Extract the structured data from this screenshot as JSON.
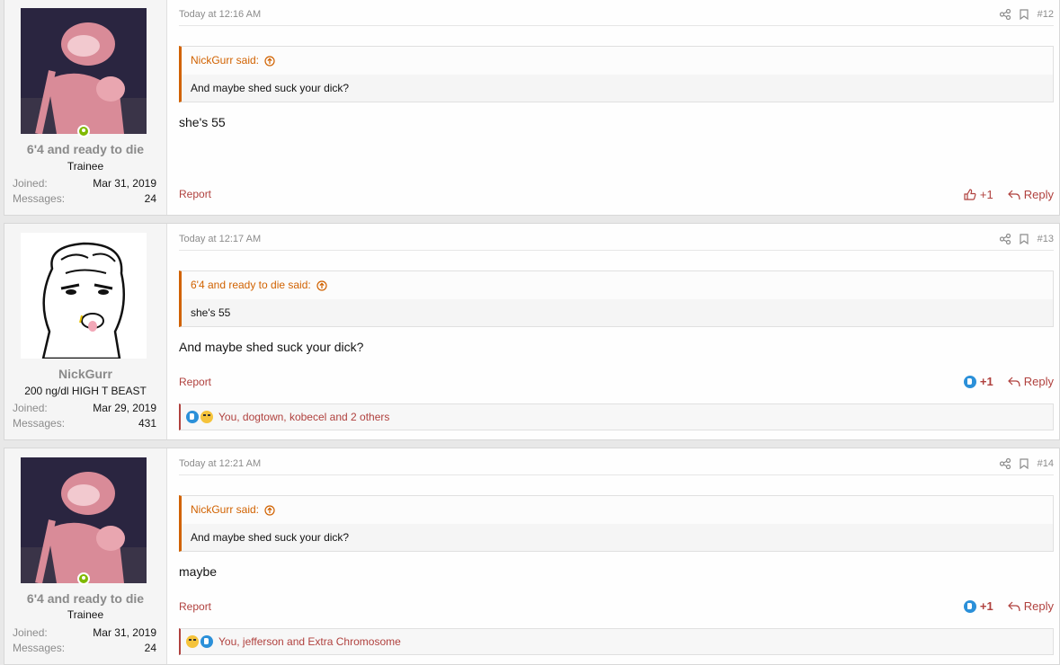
{
  "posts": [
    {
      "user": {
        "name": "6'4 and ready to die",
        "title": "Trainee",
        "joined_label": "Joined:",
        "joined": "Mar 31, 2019",
        "messages_label": "Messages:",
        "messages": "24"
      },
      "time": "Today at 12:16 AM",
      "number": "#12",
      "quote": {
        "author": "NickGurr said:",
        "text": "And maybe shed suck your dick?"
      },
      "text": "she's 55",
      "report": "Report",
      "like": "+1",
      "reply": "Reply"
    },
    {
      "user": {
        "name": "NickGurr",
        "title": "200 ng/dl HIGH T BEAST",
        "joined_label": "Joined:",
        "joined": "Mar 29, 2019",
        "messages_label": "Messages:",
        "messages": "431"
      },
      "time": "Today at 12:17 AM",
      "number": "#13",
      "quote": {
        "author": "6'4 and ready to die said:",
        "text": "she's 55"
      },
      "text": "And maybe shed suck your dick?",
      "report": "Report",
      "like": "+1",
      "reply": "Reply",
      "reactions": "You, dogtown, kobecel and 2 others"
    },
    {
      "user": {
        "name": "6'4 and ready to die",
        "title": "Trainee",
        "joined_label": "Joined:",
        "joined": "Mar 31, 2019",
        "messages_label": "Messages:",
        "messages": "24"
      },
      "time": "Today at 12:21 AM",
      "number": "#14",
      "quote": {
        "author": "NickGurr said:",
        "text": "And maybe shed suck your dick?"
      },
      "text": "maybe",
      "report": "Report",
      "like": "+1",
      "reply": "Reply",
      "reactions": "You, jefferson and Extra Chromosome"
    }
  ],
  "colors": {
    "accent": "#b0413e",
    "quote_border": "#d16200",
    "online": "#7fb900",
    "like_blue": "#2b90d9"
  }
}
